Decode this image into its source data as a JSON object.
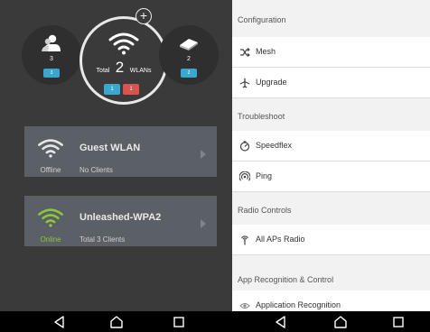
{
  "overview": {
    "users": {
      "count": "3",
      "badge": "3",
      "icon": "users-icon"
    },
    "wlans": {
      "total_word": "Total",
      "total": "2",
      "unit": "WLANs",
      "badge_blue": "1",
      "badge_red": "1",
      "icon": "wifi-icon"
    },
    "aps": {
      "count": "2",
      "badge": "2",
      "icon": "access-point-icon"
    },
    "add_icon": "plus-icon"
  },
  "wlans": [
    {
      "name": "Guest WLAN",
      "status": "Offline",
      "clients": "No Clients",
      "icon_color": "#e6e6e6"
    },
    {
      "name": "Unleashed-WPA2",
      "status": "Online",
      "clients": "Total 3 Clients",
      "icon_color": "#8cc63f"
    }
  ],
  "menu": {
    "configuration": {
      "title": "Configuration",
      "items": [
        {
          "label": "Mesh",
          "icon": "shuffle-icon"
        },
        {
          "label": "Upgrade",
          "icon": "airplane-icon"
        }
      ]
    },
    "troubleshoot": {
      "title": "Troubleshoot",
      "items": [
        {
          "label": "Speedflex",
          "icon": "speedometer-icon"
        },
        {
          "label": "Ping",
          "icon": "ping-icon"
        }
      ]
    },
    "radio_controls": {
      "title": "Radio Controls",
      "items": [
        {
          "label": "All APs Radio",
          "icon": "antenna-icon"
        }
      ]
    },
    "app_recognition": {
      "title": "App Recognition & Control",
      "items": [
        {
          "label": "Application Recognition",
          "icon": "eye-icon"
        }
      ]
    }
  },
  "colors": {
    "accent_blue": "#3aa8cc",
    "alert_red": "#d9534f",
    "online_green": "#8cc63f",
    "panel_dark": "#3a3a3a",
    "card": "#5a6065"
  }
}
